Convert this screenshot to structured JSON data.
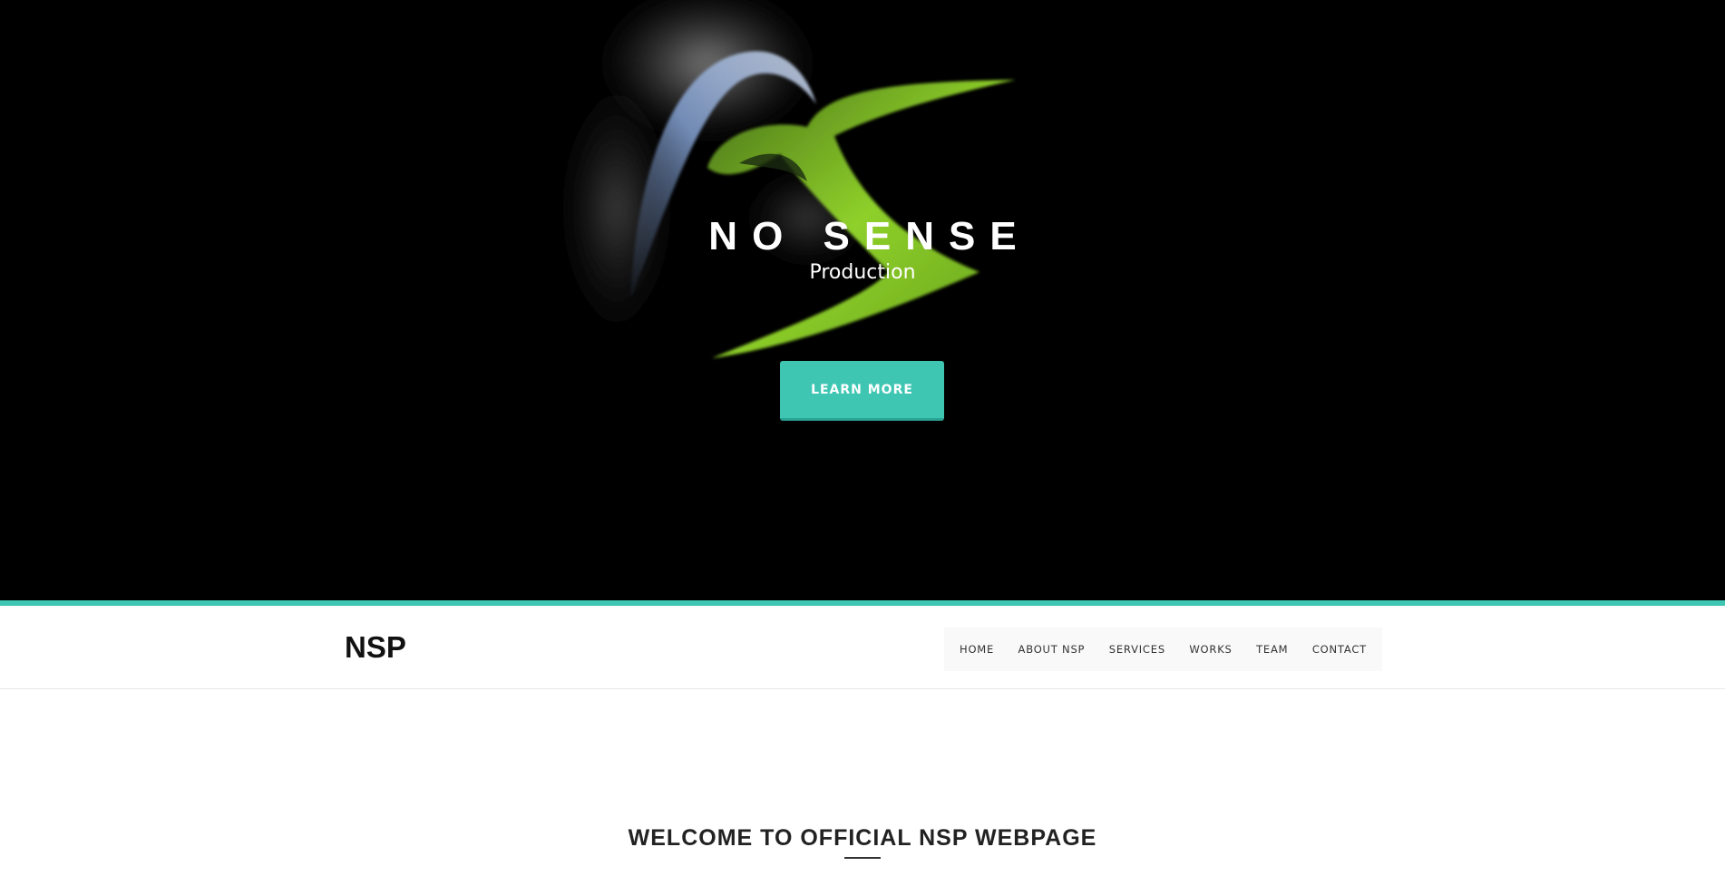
{
  "hero": {
    "title": "NO SENSE",
    "subtitle": "Production",
    "cta_label": "LEARN MORE",
    "accent_color": "#3ec6b3",
    "background_color": "#000000",
    "art": "green-swirl-logo"
  },
  "navbar": {
    "brand": "NSP",
    "items": [
      {
        "label": "HOME"
      },
      {
        "label": "ABOUT NSP"
      },
      {
        "label": "SERVICES"
      },
      {
        "label": "WORKS"
      },
      {
        "label": "TEAM"
      },
      {
        "label": "CONTACT"
      }
    ]
  },
  "section": {
    "heading": "WELCOME TO OFFICIAL NSP WEBPAGE"
  }
}
